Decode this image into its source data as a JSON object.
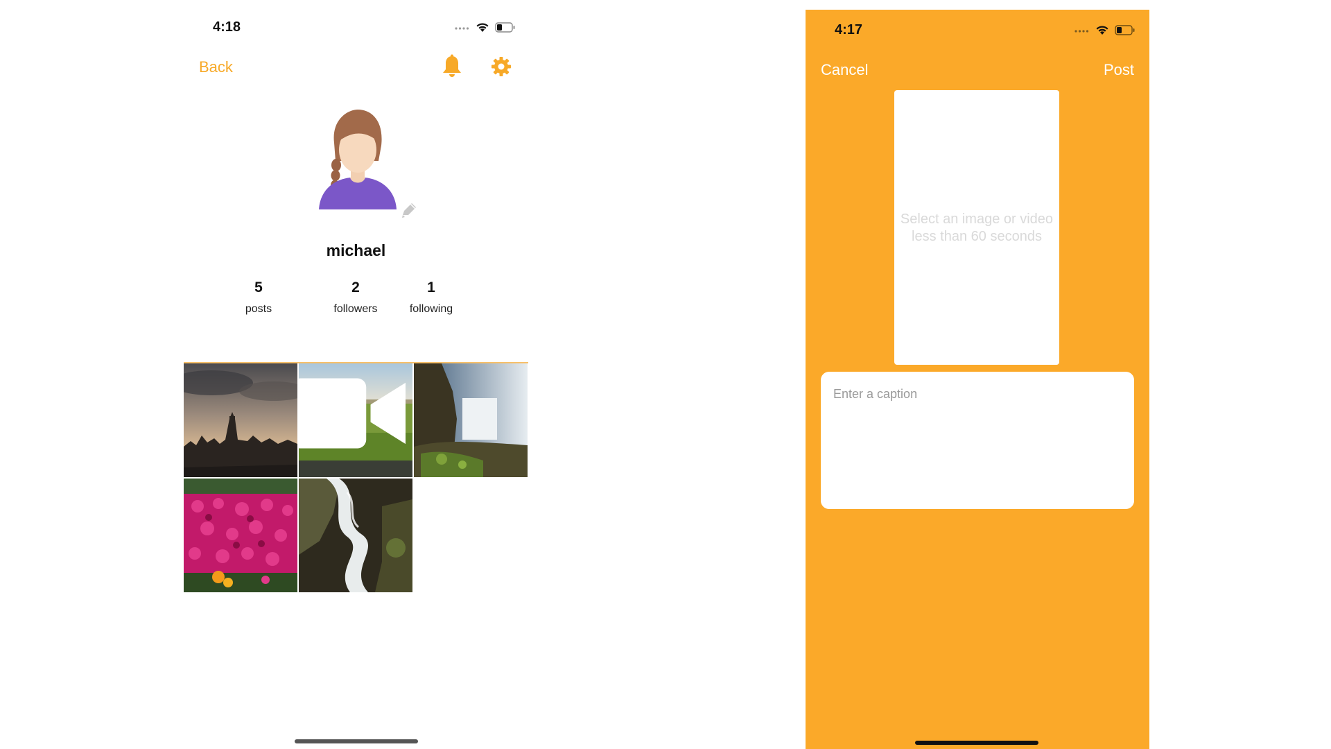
{
  "colors": {
    "accent": "#F7A928",
    "orange_background": "#FBA929",
    "white": "#FFFFFF"
  },
  "profile_screen": {
    "status_time": "4:18",
    "nav": {
      "back_label": "Back",
      "bell_icon": "bell-icon",
      "settings_icon": "gear-icon"
    },
    "avatar_icon": "avatar-icon",
    "edit_icon": "pencil-icon",
    "username": "michael",
    "stats": [
      {
        "value": "5",
        "label": "posts"
      },
      {
        "value": "2",
        "label": "followers"
      },
      {
        "value": "1",
        "label": "following"
      }
    ],
    "posts": [
      {
        "subject": "city skyline at dusk with clock tower",
        "is_video": false
      },
      {
        "subject": "person in a green field",
        "is_video": true
      },
      {
        "subject": "waterfall over mossy cliffs",
        "is_video": false
      },
      {
        "subject": "magenta flower bed",
        "is_video": false
      },
      {
        "subject": "long-exposure waterfall",
        "is_video": false
      }
    ]
  },
  "new_post_screen": {
    "status_time": "4:17",
    "cancel_label": "Cancel",
    "post_label": "Post",
    "media_hint_line1": "Select an image or video",
    "media_hint_line2": "less than 60 seconds",
    "caption_placeholder": "Enter a caption"
  }
}
